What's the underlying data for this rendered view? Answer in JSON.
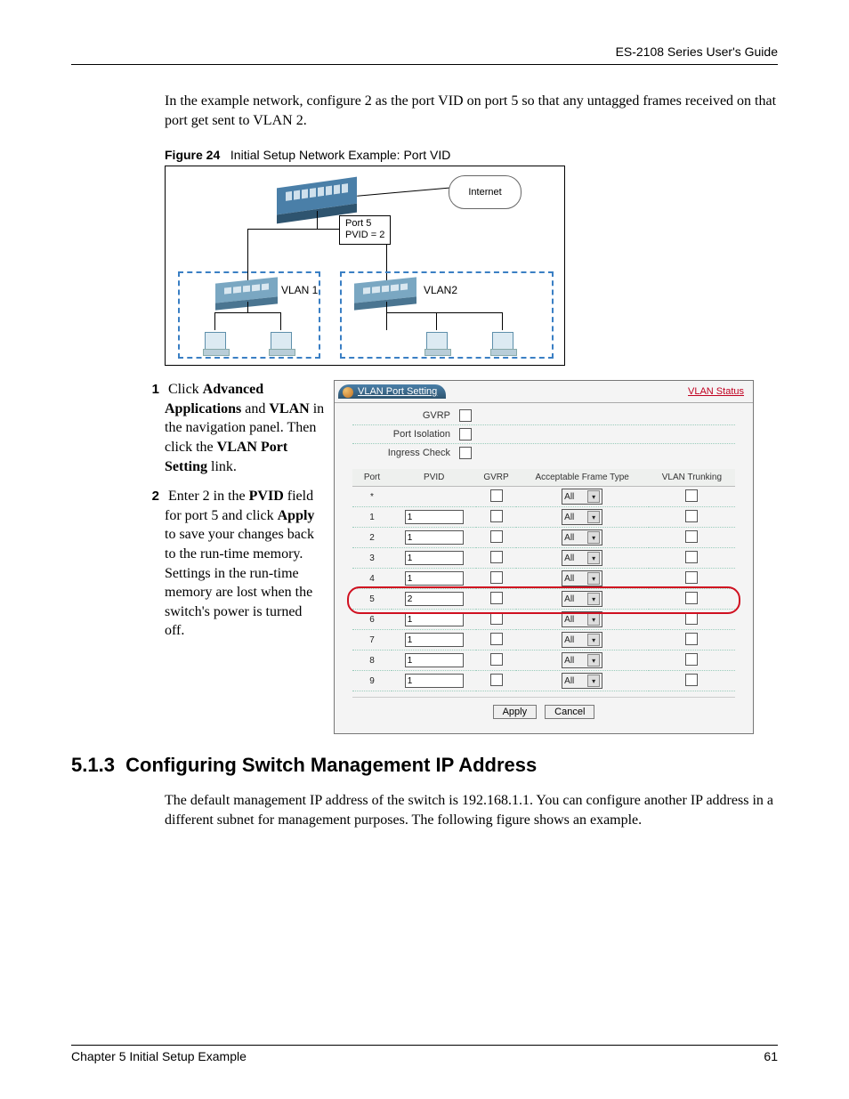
{
  "header": {
    "guide_title": "ES-2108 Series User's Guide"
  },
  "intro_para": "In the example network, configure 2 as the port VID on port 5 so that any untagged frames received on that port get sent to VLAN 2.",
  "figure": {
    "label": "Figure 24",
    "caption": "Initial Setup Network Example: Port VID",
    "internet": "Internet",
    "port_label_l1": "Port 5",
    "port_label_l2": "PVID = 2",
    "vlan1": "VLAN 1",
    "vlan2": "VLAN2"
  },
  "steps": {
    "s1_num": "1",
    "s1_text_a": "Click ",
    "s1_b1": "Advanced Applications",
    "s1_text_b": " and ",
    "s1_b2": "VLAN",
    "s1_text_c": " in the navigation panel. Then click the ",
    "s1_b3": "VLAN Port Setting",
    "s1_text_d": " link.",
    "s2_num": "2",
    "s2_text_a": "Enter 2 in the ",
    "s2_b1": "PVID",
    "s2_text_b": " field for port 5 and click ",
    "s2_b2": "Apply",
    "s2_text_c": " to save your changes back to the run-time memory. Settings in the run-time memory are lost when the switch's power is turned off."
  },
  "ui": {
    "tab_title": "VLAN Port Setting",
    "status_link": "VLAN Status",
    "opts": {
      "gvrp": "GVRP",
      "iso": "Port Isolation",
      "ingress": "Ingress Check"
    },
    "cols": {
      "port": "Port",
      "pvid": "PVID",
      "gvrp": "GVRP",
      "aft": "Acceptable Frame Type",
      "trunk": "VLAN Trunking"
    },
    "aft_value": "All",
    "rows": [
      {
        "port": "*",
        "pvid": ""
      },
      {
        "port": "1",
        "pvid": "1"
      },
      {
        "port": "2",
        "pvid": "1"
      },
      {
        "port": "3",
        "pvid": "1"
      },
      {
        "port": "4",
        "pvid": "1"
      },
      {
        "port": "5",
        "pvid": "2"
      },
      {
        "port": "6",
        "pvid": "1"
      },
      {
        "port": "7",
        "pvid": "1"
      },
      {
        "port": "8",
        "pvid": "1"
      },
      {
        "port": "9",
        "pvid": "1"
      }
    ],
    "apply": "Apply",
    "cancel": "Cancel"
  },
  "section": {
    "num": "5.1.3",
    "title": "Configuring Switch Management IP Address",
    "para": "The default management IP address of the switch is 192.168.1.1. You can configure another IP address in a different subnet for management purposes. The following figure shows an example."
  },
  "footer": {
    "chapter": "Chapter 5 Initial Setup Example",
    "page": "61"
  }
}
